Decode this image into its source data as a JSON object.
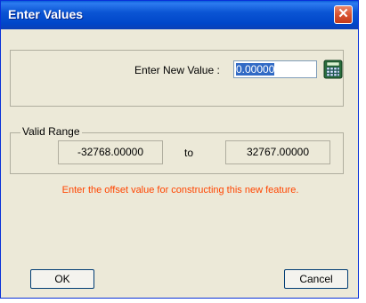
{
  "window": {
    "title": "Enter Values"
  },
  "input": {
    "label": "Enter New Value :",
    "value": "0.00000"
  },
  "range": {
    "group_label": "Valid Range",
    "min": "-32768.00000",
    "separator": "to",
    "max": "32767.00000"
  },
  "hint": "Enter the offset value for constructing this new feature.",
  "buttons": {
    "ok": "OK",
    "cancel": "Cancel"
  },
  "colors": {
    "titlebar": "#0b55d4",
    "hint": "#ff4500",
    "dialog_bg": "#ece9d8",
    "close": "#d9532f"
  },
  "icons": {
    "close": "close-icon",
    "calculator": "calculator-icon"
  }
}
